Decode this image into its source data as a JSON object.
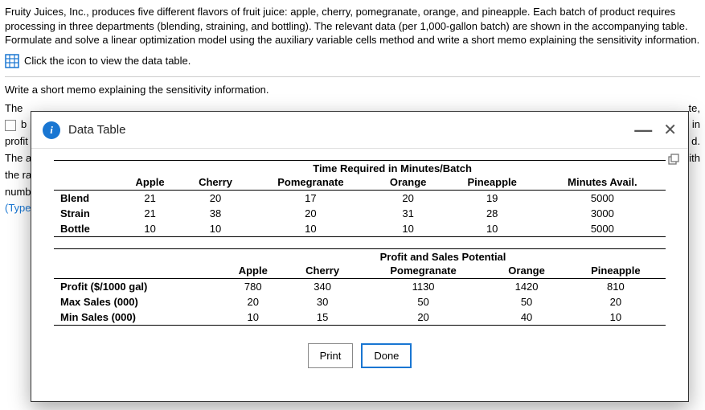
{
  "problem": {
    "text": "Fruity Juices, Inc., produces five different flavors of fruit juice: apple, cherry, pomegranate, orange, and pineapple. Each batch of product requires processing in three departments (blending, straining, and bottling). The relevant data (per 1,000-gallon batch) are shown in the accompanying table. Formulate and solve a linear optimization model using the auxiliary variable cells method and write a short memo explaining the sensitivity information.",
    "icon_hint": "Click the icon to view the data table.",
    "memo_prompt": "Write a short memo explaining the sensitivity information."
  },
  "background_fragments": {
    "the": "The",
    "b": "b",
    "profit": "profit",
    "the_a": "The a",
    "the_ra": "the ra",
    "numb": "numb",
    "type": "(Type",
    "te": "te,",
    "in": "in",
    "d": "d.",
    "with": "with"
  },
  "modal": {
    "title": "Data Table",
    "print": "Print",
    "done": "Done"
  },
  "table1": {
    "caption": "Time Required in Minutes/Batch",
    "cols": [
      "Apple",
      "Cherry",
      "Pomegranate",
      "Orange",
      "Pineapple",
      "Minutes Avail."
    ],
    "rows": [
      {
        "label": "Blend",
        "cells": [
          "21",
          "20",
          "17",
          "20",
          "19",
          "5000"
        ]
      },
      {
        "label": "Strain",
        "cells": [
          "21",
          "38",
          "20",
          "31",
          "28",
          "3000"
        ]
      },
      {
        "label": "Bottle",
        "cells": [
          "10",
          "10",
          "10",
          "10",
          "10",
          "5000"
        ]
      }
    ]
  },
  "table2": {
    "caption": "Profit and Sales Potential",
    "cols": [
      "Apple",
      "Cherry",
      "Pomegranate",
      "Orange",
      "Pineapple"
    ],
    "rows": [
      {
        "label": "Profit ($/1000 gal)",
        "cells": [
          "780",
          "340",
          "1130",
          "1420",
          "810"
        ]
      },
      {
        "label": "Max Sales (000)",
        "cells": [
          "20",
          "30",
          "50",
          "50",
          "20"
        ]
      },
      {
        "label": "Min Sales (000)",
        "cells": [
          "10",
          "15",
          "20",
          "40",
          "10"
        ]
      }
    ]
  }
}
